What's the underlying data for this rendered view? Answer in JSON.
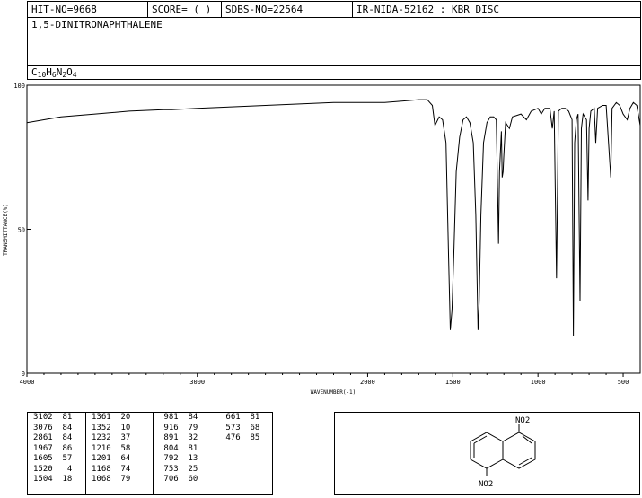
{
  "header": {
    "hit_no": "HIT-NO=9668",
    "score": "SCORE=  (   )",
    "sdbs_no": "SDBS-NO=22564",
    "ir_nida": "IR-NIDA-52162 : KBR DISC"
  },
  "compound": {
    "name": "1,5-DINITRONAPHTHALENE",
    "formula_parts": [
      "C",
      "10",
      "H",
      "6",
      "N",
      "2",
      "O",
      "4"
    ]
  },
  "chart_data": {
    "type": "line",
    "ylabel": "TRANSMITTANCE(%)",
    "xlabel": "WAVENUMBER(-1)",
    "xlim": [
      4000,
      400
    ],
    "ylim": [
      0,
      100
    ],
    "x_ticks": [
      4000,
      3000,
      2000,
      1500,
      1000,
      500
    ],
    "y_ticks": [
      0,
      50,
      100
    ],
    "baseline": [
      [
        4000,
        87
      ],
      [
        3800,
        89
      ],
      [
        3600,
        90
      ],
      [
        3400,
        91
      ],
      [
        3200,
        91.5
      ],
      [
        3150,
        91.5
      ],
      [
        3000,
        92
      ],
      [
        2800,
        92.5
      ],
      [
        2600,
        93
      ],
      [
        2400,
        93.5
      ],
      [
        2200,
        94
      ],
      [
        2100,
        94
      ],
      [
        1900,
        94
      ],
      [
        1800,
        94.5
      ],
      [
        1700,
        95
      ],
      [
        1650,
        95
      ],
      [
        1620,
        93
      ],
      [
        1605,
        86
      ],
      [
        1580,
        89
      ],
      [
        1560,
        88
      ],
      [
        1540,
        80
      ],
      [
        1525,
        40
      ],
      [
        1515,
        15
      ],
      [
        1505,
        22
      ],
      [
        1495,
        40
      ],
      [
        1480,
        70
      ],
      [
        1460,
        82
      ],
      [
        1440,
        88
      ],
      [
        1420,
        89
      ],
      [
        1400,
        87
      ],
      [
        1380,
        80
      ],
      [
        1365,
        55
      ],
      [
        1352,
        15
      ],
      [
        1345,
        25
      ],
      [
        1335,
        55
      ],
      [
        1320,
        80
      ],
      [
        1300,
        87
      ],
      [
        1280,
        89
      ],
      [
        1260,
        89
      ],
      [
        1245,
        88
      ],
      [
        1236,
        60
      ],
      [
        1232,
        45
      ],
      [
        1226,
        70
      ],
      [
        1215,
        84
      ],
      [
        1210,
        68
      ],
      [
        1205,
        70
      ],
      [
        1201,
        75
      ],
      [
        1190,
        87
      ],
      [
        1168,
        85
      ],
      [
        1150,
        89
      ],
      [
        1100,
        90
      ],
      [
        1068,
        88
      ],
      [
        1040,
        91
      ],
      [
        1000,
        92
      ],
      [
        981,
        90
      ],
      [
        960,
        92
      ],
      [
        930,
        92
      ],
      [
        916,
        85
      ],
      [
        905,
        91
      ],
      [
        891,
        33
      ],
      [
        880,
        91
      ],
      [
        860,
        92
      ],
      [
        840,
        92
      ],
      [
        820,
        91
      ],
      [
        800,
        88
      ],
      [
        792,
        13
      ],
      [
        785,
        80
      ],
      [
        775,
        88
      ],
      [
        765,
        90
      ],
      [
        753,
        25
      ],
      [
        745,
        85
      ],
      [
        735,
        90
      ],
      [
        715,
        88
      ],
      [
        706,
        60
      ],
      [
        700,
        85
      ],
      [
        690,
        91
      ],
      [
        670,
        92
      ],
      [
        661,
        80
      ],
      [
        650,
        92
      ],
      [
        620,
        93
      ],
      [
        600,
        93
      ],
      [
        573,
        68
      ],
      [
        565,
        92
      ],
      [
        540,
        94
      ],
      [
        520,
        93
      ],
      [
        500,
        90
      ],
      [
        476,
        88
      ],
      [
        460,
        92
      ],
      [
        440,
        94
      ],
      [
        420,
        93
      ],
      [
        400,
        86
      ]
    ],
    "peaks": [
      {
        "x": 3102,
        "y": 81
      },
      {
        "x": 3076,
        "y": 84
      },
      {
        "x": 2861,
        "y": 84
      },
      {
        "x": 1967,
        "y": 86
      },
      {
        "x": 1605,
        "y": 57
      },
      {
        "x": 1520,
        "y": 4
      },
      {
        "x": 1504,
        "y": 18
      },
      {
        "x": 1361,
        "y": 20
      },
      {
        "x": 1352,
        "y": 10
      },
      {
        "x": 1232,
        "y": 37
      },
      {
        "x": 1210,
        "y": 58
      },
      {
        "x": 1201,
        "y": 64
      },
      {
        "x": 1168,
        "y": 74
      },
      {
        "x": 1068,
        "y": 79
      },
      {
        "x": 981,
        "y": 84
      },
      {
        "x": 916,
        "y": 79
      },
      {
        "x": 891,
        "y": 32
      },
      {
        "x": 804,
        "y": 81
      },
      {
        "x": 792,
        "y": 13
      },
      {
        "x": 753,
        "y": 25
      },
      {
        "x": 706,
        "y": 60
      },
      {
        "x": 661,
        "y": 81
      },
      {
        "x": 573,
        "y": 68
      },
      {
        "x": 476,
        "y": 85
      }
    ]
  },
  "peak_table": {
    "columns": [
      [
        "3102  81",
        "3076  84",
        "2861  84",
        "1967  86",
        "1605  57",
        "1520   4",
        "1504  18"
      ],
      [
        "1361  20",
        "1352  10",
        "1232  37",
        "1210  58",
        "1201  64",
        "1168  74",
        "1068  79"
      ],
      [
        " 981  84",
        " 916  79",
        " 891  32",
        " 804  81",
        " 792  13",
        " 753  25",
        " 706  60"
      ],
      [
        " 661  81",
        " 573  68",
        " 476  85"
      ]
    ]
  },
  "structure": {
    "top_label": "NO2",
    "bottom_label": "NO2"
  }
}
